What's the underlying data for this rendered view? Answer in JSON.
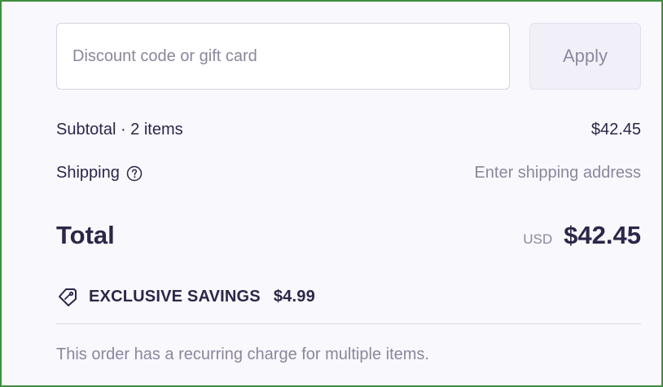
{
  "discount": {
    "placeholder": "Discount code or gift card",
    "apply_label": "Apply"
  },
  "summary": {
    "subtotal_label": "Subtotal · 2 items",
    "subtotal_value": "$42.45",
    "shipping_label": "Shipping",
    "shipping_icon": "help-circle-icon",
    "shipping_value": "Enter shipping address",
    "total_label": "Total",
    "total_currency": "USD",
    "total_value": "$42.45"
  },
  "savings": {
    "icon": "tag-icon",
    "label": "EXCLUSIVE SAVINGS",
    "amount": "$4.99"
  },
  "note": "This order has a recurring charge for multiple items.",
  "colors": {
    "text": "#2b2748",
    "muted": "#8a879c",
    "background": "#f9f8fd",
    "border": "#3f8f3f"
  }
}
